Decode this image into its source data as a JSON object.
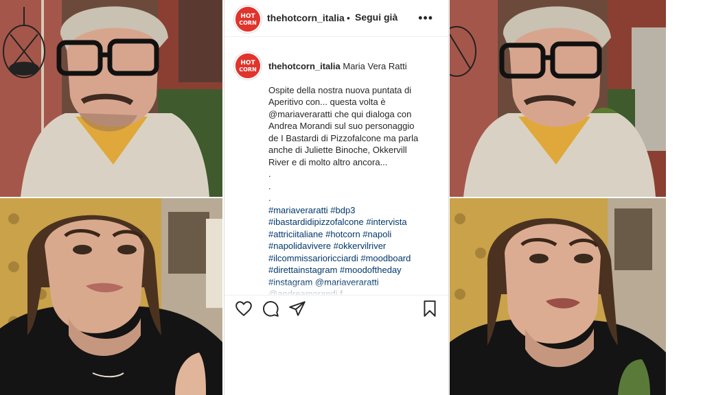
{
  "header": {
    "username": "thehotcorn_italia",
    "separator": "•",
    "follow_label": "Segui già",
    "more_label": "•••"
  },
  "avatar": {
    "logo_text_top": "HOT",
    "logo_text_bottom": "CORN"
  },
  "caption": {
    "username": "thehotcorn_italia",
    "title": "Maria Vera Ratti",
    "body_lines": [
      "Ospite della nostra nuova puntata di",
      "Aperitivo con... questa volta è",
      "@mariaveraratti che qui dialoga con",
      "Andrea Morandi sul suo personaggio",
      "de I Bastardi di Pizzofalcone ma parla",
      "anche di Juliette Binoche, Okkervill",
      "River e di molto altro ancora...",
      ".",
      ".",
      "."
    ],
    "hashtag_lines": [
      "#mariaveraratti #bdp3",
      "#ibastardidipizzofalcone #intervista",
      "#attriciitaliane #hotcorn #napoli",
      "#napolidavivere #okkervilriver",
      "#ilcommissarioricciardi #moodboard",
      "#direttainstagram #moodoftheday",
      "#instagram @mariaveraratti",
      "@andreamorandi f..."
    ]
  },
  "actions": {
    "like": "heart-icon",
    "comment": "comment-icon",
    "share": "share-icon",
    "save": "bookmark-icon"
  },
  "colors": {
    "brand": "#e0342c",
    "link": "#00376b",
    "text": "#262626"
  }
}
